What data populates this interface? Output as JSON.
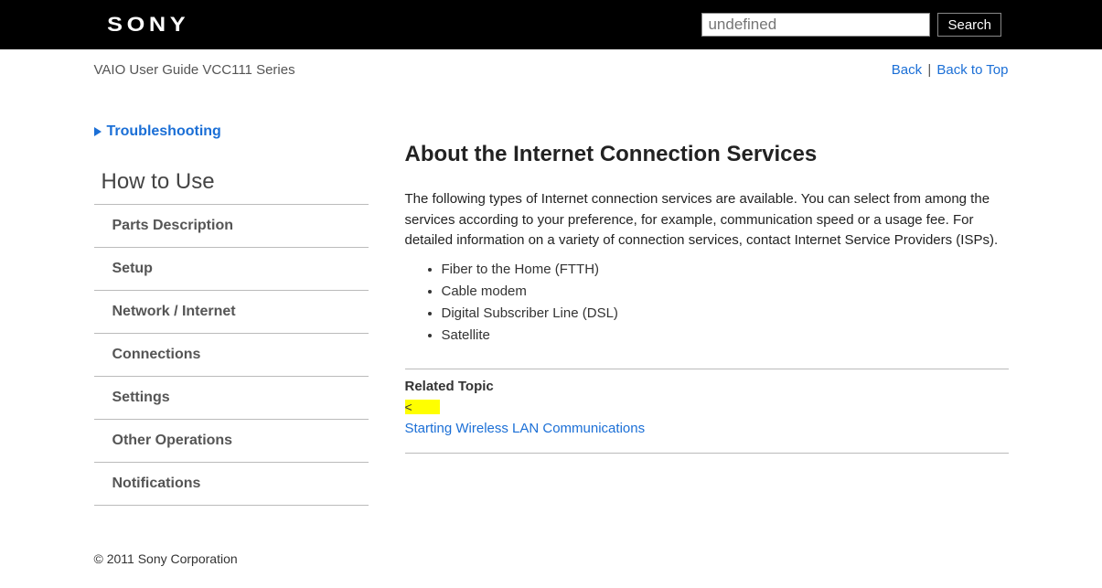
{
  "header": {
    "logo_text": "SONY",
    "search_placeholder": "undefined",
    "search_button": "Search"
  },
  "subheader": {
    "title": "VAIO User Guide VCC111 Series",
    "back_label": "Back",
    "back_to_top_label": "Back to Top"
  },
  "sidebar": {
    "troubleshooting": "Troubleshooting",
    "section_heading": "How to Use",
    "items": [
      "Parts Description",
      "Setup",
      "Network / Internet",
      "Connections",
      "Settings",
      "Other Operations",
      "Notifications"
    ]
  },
  "main": {
    "title": "About the Internet Connection Services",
    "intro": "The following types of Internet connection services are available. You can select from among the services according to your preference, for example, communication speed or a usage fee. For detailed information on a variety of connection services, contact Internet Service Providers (ISPs).",
    "bullets": [
      "Fiber to the Home (FTTH)",
      "Cable modem",
      "Digital Subscriber Line (DSL)",
      "Satellite"
    ],
    "related_title": "Related Topic",
    "highlight_text": "<",
    "related_link": "Starting Wireless LAN Communications"
  },
  "footer": {
    "copyright": "© 2011 Sony Corporation"
  }
}
